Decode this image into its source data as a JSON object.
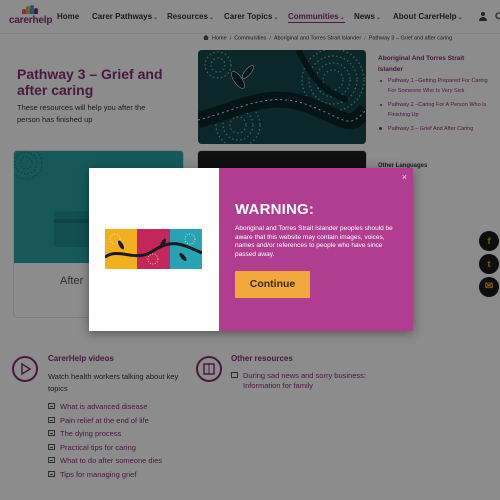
{
  "header": {
    "logo_text": "carerhelp",
    "nav": [
      {
        "label": "Home",
        "has_menu": false,
        "active": false
      },
      {
        "label": "Carer Pathways",
        "has_menu": true,
        "active": false
      },
      {
        "label": "Resources",
        "has_menu": true,
        "active": false
      },
      {
        "label": "Carer Topics",
        "has_menu": true,
        "active": false
      },
      {
        "label": "Communities",
        "has_menu": true,
        "active": true
      },
      {
        "label": "News",
        "has_menu": true,
        "active": false
      },
      {
        "label": "About CarerHelp",
        "has_menu": true,
        "active": false
      }
    ],
    "menu_chevron": "⌄",
    "cut_off_letter": "C"
  },
  "breadcrumb": {
    "items": [
      "Home",
      "Communities",
      "Aboriginal and Torres Strait Islander",
      "Pathway 3 – Grief and after caring"
    ],
    "separator": "/"
  },
  "hero": {
    "title": "Pathway 3 – Grief and after caring",
    "intro": "These resources will help you after the person has finished up"
  },
  "sidebar": {
    "heading": "Aboriginal And Torres Strait Islander",
    "items": [
      {
        "label": "Pathway 1 –Getting Prepared For Caring For Someone Who Is Very Sick",
        "current": false
      },
      {
        "label": "Pathway 2 –Caring For A Person Who Is Finishing Up",
        "current": false
      },
      {
        "label": "Pathway 3 – Grief And After Caring",
        "current": true
      }
    ],
    "other_languages": "Other Languages"
  },
  "cards": {
    "left_label": "After"
  },
  "videos": {
    "title": "CarerHelp videos",
    "description": "Watch health workers talking about key topics",
    "links": [
      "What is advanced disease",
      "Pain relief at the end of life",
      "The dying process",
      "Practical tips for caring",
      "What to do after someone dies",
      "Tips for managing grief"
    ]
  },
  "other_resources": {
    "title": "Other resources",
    "link": "During sad news and sorry business: Information for family"
  },
  "share": {
    "facebook": "f",
    "twitter": "t",
    "email": "✉"
  },
  "modal": {
    "close": "×",
    "title": "WARNING:",
    "text": "Aboriginal and Torres Strait Islander peoples should be aware that this website may contain images, voices, names and/or references to people who have since passed away.",
    "button": "Continue"
  },
  "colors": {
    "brand_purple": "#8a2c7a",
    "modal_magenta": "#b03d90",
    "button_orange": "#f3a83b",
    "share_yellow": "#e8a900",
    "card_teal": "#2aa3a6"
  },
  "icons": {
    "user": "user-icon",
    "home": "home-icon",
    "video": "play-icon",
    "resources": "book-icon",
    "document": "document-icon",
    "close": "close-icon"
  }
}
